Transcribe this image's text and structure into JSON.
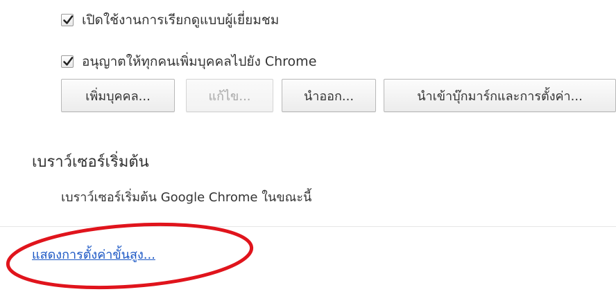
{
  "people": {
    "guest_browsing": {
      "label": "เปิดใช้งานการเรียกดูแบบผู้เยี่ยมชม",
      "checked": true
    },
    "anyone_add": {
      "label": "อนุญาตให้ทุกคนเพิ่มบุคคลไปยัง Chrome",
      "checked": true
    },
    "buttons": {
      "add": "เพิ่มบุคคล...",
      "edit": "แก้ไข...",
      "export": "นำออก...",
      "import": "นำเข้าบุ๊กมาร์กและการตั้งค่า..."
    }
  },
  "default_browser": {
    "title": "เบราว์เซอร์เริ่มต้น",
    "description": "เบราว์เซอร์เริ่มต้น Google Chrome ในขณะนี้"
  },
  "advanced": {
    "link_text": "แสดงการตั้งค่าขั้นสูง..."
  },
  "colors": {
    "link": "#1a56c4",
    "highlight": "#e0141c",
    "divider": "#e6e6e6"
  }
}
